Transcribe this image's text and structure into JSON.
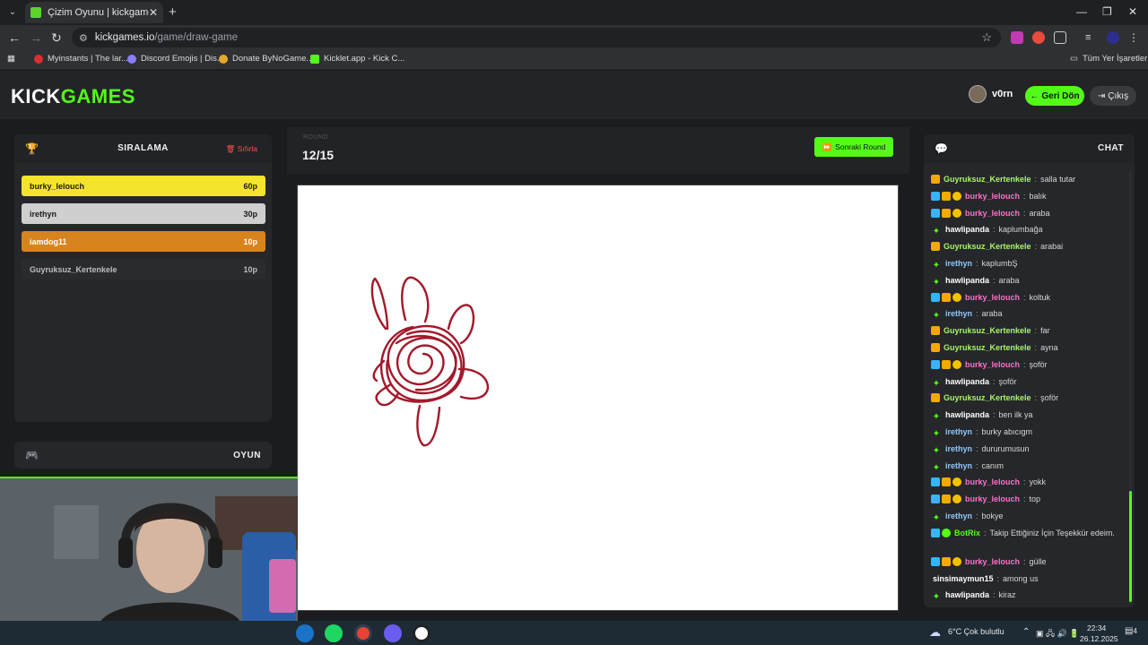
{
  "browser": {
    "tab_title": "Çizim Oyunu | kickgames.io",
    "url_host": "kickgames.io",
    "url_path": "/game/draw-game",
    "bookmarks": [
      "Myinstants | The lar...",
      "Discord Emojis | Dis...",
      "Donate ByNoGame...",
      "Kicklet.app - Kick C..."
    ],
    "all_bookmarks": "Tüm Yer İşaretleri"
  },
  "header": {
    "logo_kick": "KICK",
    "logo_games": "GAMES",
    "username": "v0rn",
    "back_button": "Geri Dön",
    "logout_button": "Çıkış"
  },
  "ranking": {
    "title": "SIRALAMA",
    "reset": "Sıfırla",
    "rows": [
      {
        "name": "burky_lelouch",
        "points": "60p",
        "bg": "#f6e32b",
        "fg": "#1a1a1a"
      },
      {
        "name": "irethyn",
        "points": "30p",
        "bg": "#cfcfcf",
        "fg": "#1a1a1a"
      },
      {
        "name": "iamdog11",
        "points": "10p",
        "bg": "#d7841e",
        "fg": "#ffffff"
      },
      {
        "name": "Guyruksuz_Kertenkele",
        "points": "10p",
        "bg": "#2a2b2e",
        "fg": "#bdbdbd"
      }
    ]
  },
  "game_panel": {
    "title": "OYUN"
  },
  "round": {
    "label": "ROUND",
    "value": "12/15",
    "next_button": "Sonraki Round"
  },
  "chat": {
    "title": "CHAT",
    "messages": [
      {
        "badges": [
          "gold"
        ],
        "user": "Guyruksuz_Kertenkele",
        "color": "#a8f56a",
        "text": "salla tutar"
      },
      {
        "badges": [
          "blue",
          "gold",
          "coin"
        ],
        "user": "burky_lelouch",
        "color": "#ff6ec7",
        "text": "balık"
      },
      {
        "badges": [
          "blue",
          "gold",
          "coin"
        ],
        "user": "burky_lelouch",
        "color": "#ff6ec7",
        "text": "araba"
      },
      {
        "badges": [
          "spark"
        ],
        "user": "hawlipanda",
        "color": "#ffffff",
        "text": "kaplumbağa"
      },
      {
        "badges": [
          "gold"
        ],
        "user": "Guyruksuz_Kertenkele",
        "color": "#a8f56a",
        "text": "arabai"
      },
      {
        "badges": [
          "spark"
        ],
        "user": "irethyn",
        "color": "#8ec9ff",
        "text": "kaplumbŞ"
      },
      {
        "badges": [
          "spark"
        ],
        "user": "hawlipanda",
        "color": "#ffffff",
        "text": "araba"
      },
      {
        "badges": [
          "blue",
          "gold",
          "coin"
        ],
        "user": "burky_lelouch",
        "color": "#ff6ec7",
        "text": "koltuk"
      },
      {
        "badges": [
          "spark"
        ],
        "user": "irethyn",
        "color": "#8ec9ff",
        "text": "araba"
      },
      {
        "badges": [
          "gold"
        ],
        "user": "Guyruksuz_Kertenkele",
        "color": "#a8f56a",
        "text": "far"
      },
      {
        "badges": [
          "gold"
        ],
        "user": "Guyruksuz_Kertenkele",
        "color": "#a8f56a",
        "text": "ayna"
      },
      {
        "badges": [
          "blue",
          "gold",
          "coin"
        ],
        "user": "burky_lelouch",
        "color": "#ff6ec7",
        "text": "şoför"
      },
      {
        "badges": [
          "spark"
        ],
        "user": "hawlipanda",
        "color": "#ffffff",
        "text": "şoför"
      },
      {
        "badges": [
          "gold"
        ],
        "user": "Guyruksuz_Kertenkele",
        "color": "#a8f56a",
        "text": "şoför"
      },
      {
        "badges": [
          "spark"
        ],
        "user": "hawlipanda",
        "color": "#ffffff",
        "text": "ben ilk ya"
      },
      {
        "badges": [
          "spark"
        ],
        "user": "irethyn",
        "color": "#8ec9ff",
        "text": "burky abıcıgm"
      },
      {
        "badges": [
          "spark"
        ],
        "user": "irethyn",
        "color": "#8ec9ff",
        "text": "dururumusun"
      },
      {
        "badges": [
          "spark"
        ],
        "user": "irethyn",
        "color": "#8ec9ff",
        "text": "canım"
      },
      {
        "badges": [
          "blue",
          "gold",
          "coin"
        ],
        "user": "burky_lelouch",
        "color": "#ff6ec7",
        "text": "yokk"
      },
      {
        "badges": [
          "blue",
          "gold",
          "coin"
        ],
        "user": "burky_lelouch",
        "color": "#ff6ec7",
        "text": "top"
      },
      {
        "badges": [
          "spark"
        ],
        "user": "irethyn",
        "color": "#8ec9ff",
        "text": "bokye"
      },
      {
        "badges": [
          "blue",
          "vip"
        ],
        "user": "BotRix",
        "color": "#53fc18",
        "text": "Takip Ettiğiniz İçin Teşekkür edeim."
      },
      {
        "badges": [
          "blue",
          "gold",
          "coin"
        ],
        "user": "burky_lelouch",
        "color": "#ff6ec7",
        "text": "gülle"
      },
      {
        "badges": [],
        "user": "sinsimaymun15",
        "color": "#ffffff",
        "text": "among us"
      },
      {
        "badges": [
          "spark"
        ],
        "user": "hawlipanda",
        "color": "#ffffff",
        "text": "kiraz"
      }
    ]
  },
  "taskbar": {
    "weather": "6°C  Çok bulutlu",
    "time": "22:34",
    "date": "26.12.2025",
    "notifications": "4"
  }
}
